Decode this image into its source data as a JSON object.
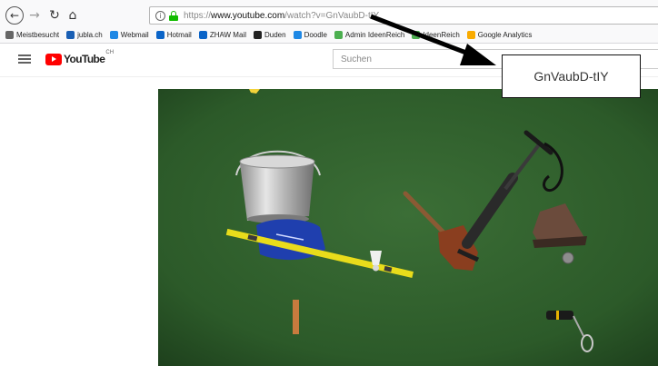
{
  "browser": {
    "url_scheme": "https://",
    "url_host": "www.youtube.com",
    "url_path": "/watch?v=GnVaubD-tIY",
    "buttons": {
      "back": "back-arrow-icon",
      "forward": "forward-arrow-icon",
      "reload": "reload-icon",
      "home": "home-icon"
    }
  },
  "bookmarks": [
    {
      "label": "Meistbesucht",
      "icon": "gear-icon",
      "color": "#666666"
    },
    {
      "label": "jubla.ch",
      "icon": "globe-icon",
      "color": "#1a5fb4"
    },
    {
      "label": "Webmail",
      "icon": "mail-icon",
      "color": "#1e88e5"
    },
    {
      "label": "Hotmail",
      "icon": "outlook-icon",
      "color": "#0a64c8"
    },
    {
      "label": "ZHAW Mail",
      "icon": "outlook-icon",
      "color": "#0a64c8"
    },
    {
      "label": "Duden",
      "icon": "duden-icon",
      "color": "#222222"
    },
    {
      "label": "Doodle",
      "icon": "doodle-icon",
      "color": "#1e88e5"
    },
    {
      "label": "Admin IdeenReich",
      "icon": "leaf-icon",
      "color": "#4caf50"
    },
    {
      "label": "IdeenReich",
      "icon": "leaf-icon",
      "color": "#4caf50"
    },
    {
      "label": "Google Analytics",
      "icon": "analytics-icon",
      "color": "#f9ab00"
    }
  ],
  "youtube": {
    "logo_text": "YouTube",
    "region": "CH",
    "search_placeholder": "Suchen"
  },
  "annotation": {
    "callout_text": "GnVaubD-tIY"
  },
  "colors": {
    "yt_red": "#ff0000",
    "turf_green": "#2f5e2c",
    "lock_green": "#12bc00"
  }
}
